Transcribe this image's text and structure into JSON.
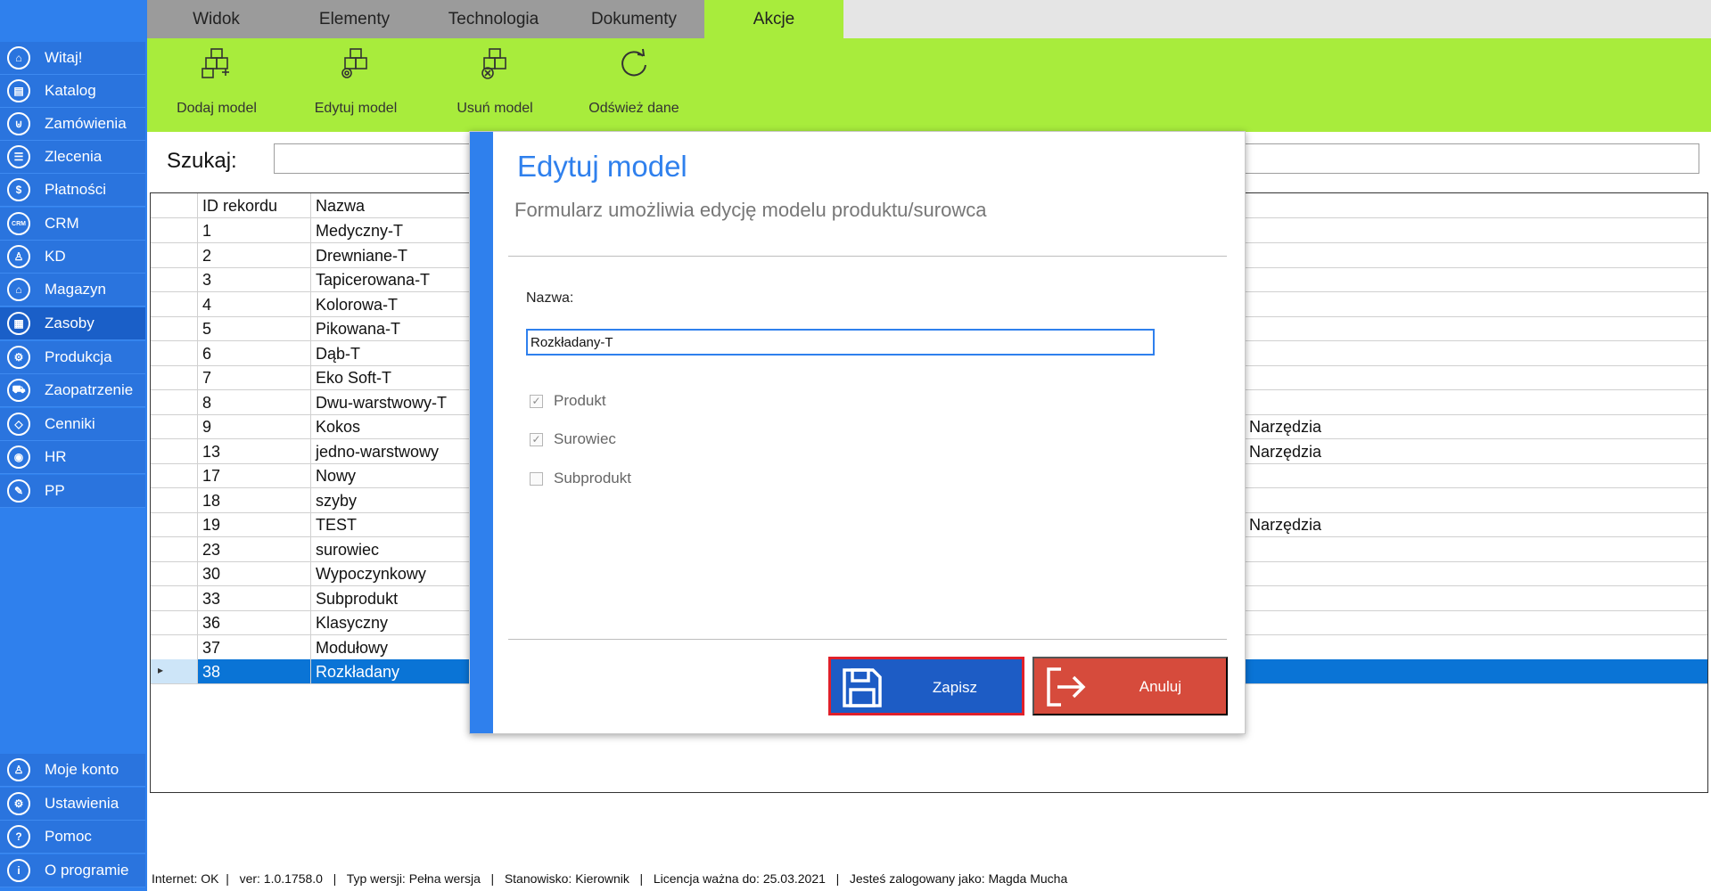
{
  "sidebar": {
    "items": [
      {
        "label": "Witaj!",
        "icon": "home-icon",
        "glyph": "⌂"
      },
      {
        "label": "Katalog",
        "icon": "book-icon",
        "glyph": "▤"
      },
      {
        "label": "Zamówienia",
        "icon": "cart-icon",
        "glyph": "⊍"
      },
      {
        "label": "Zlecenia",
        "icon": "list-icon",
        "glyph": "☰"
      },
      {
        "label": "Płatności",
        "icon": "dollar-icon",
        "glyph": "$"
      },
      {
        "label": "CRM",
        "icon": "crm-icon",
        "glyph": "CRM"
      },
      {
        "label": "KD",
        "icon": "person-icon",
        "glyph": "♙"
      },
      {
        "label": "Magazyn",
        "icon": "warehouse-icon",
        "glyph": "⌂"
      },
      {
        "label": "Zasoby",
        "icon": "resources-icon",
        "glyph": "▦"
      },
      {
        "label": "Produkcja",
        "icon": "production-icon",
        "glyph": "⚙"
      },
      {
        "label": "Zaopatrzenie",
        "icon": "truck-icon",
        "glyph": "⛟"
      },
      {
        "label": "Cenniki",
        "icon": "tag-icon",
        "glyph": "◇"
      },
      {
        "label": "HR",
        "icon": "hr-icon",
        "glyph": "◉"
      },
      {
        "label": "PP",
        "icon": "pp-icon",
        "glyph": "✎"
      }
    ],
    "bottom_items": [
      {
        "label": "Moje konto",
        "icon": "account-icon",
        "glyph": "♙"
      },
      {
        "label": "Ustawienia",
        "icon": "settings-icon",
        "glyph": "⚙"
      },
      {
        "label": "Pomoc",
        "icon": "help-icon",
        "glyph": "?"
      },
      {
        "label": "O programie",
        "icon": "info-icon",
        "glyph": "i"
      }
    ],
    "active": "Zasoby"
  },
  "tabs": [
    "Widok",
    "Elementy",
    "Technologia",
    "Dokumenty",
    "Akcje"
  ],
  "active_tab": "Akcje",
  "ribbon": {
    "buttons": [
      {
        "label": "Dodaj model",
        "icon": "add-model-icon"
      },
      {
        "label": "Edytuj model",
        "icon": "edit-model-icon"
      },
      {
        "label": "Usuń model",
        "icon": "delete-model-icon"
      },
      {
        "label": "Odśwież dane",
        "icon": "refresh-icon"
      }
    ]
  },
  "search": {
    "label": "Szukaj:",
    "value": ""
  },
  "grid": {
    "columns": [
      "ID rekordu",
      "Nazwa"
    ],
    "rows": [
      {
        "id": "1",
        "name": "Medyczny-T",
        "extra": ""
      },
      {
        "id": "2",
        "name": "Drewniane-T",
        "extra": ""
      },
      {
        "id": "3",
        "name": "Tapicerowana-T",
        "extra": ""
      },
      {
        "id": "4",
        "name": "Kolorowa-T",
        "extra": ""
      },
      {
        "id": "5",
        "name": "Pikowana-T",
        "extra": ""
      },
      {
        "id": "6",
        "name": "Dąb-T",
        "extra": ""
      },
      {
        "id": "7",
        "name": "Eko Soft-T",
        "extra": ""
      },
      {
        "id": "8",
        "name": "Dwu-warstwowy-T",
        "extra": ""
      },
      {
        "id": "9",
        "name": "Kokos",
        "extra": ", Narzędzia"
      },
      {
        "id": "13",
        "name": "jedno-warstwowy",
        "extra": ", Narzędzia"
      },
      {
        "id": "17",
        "name": "Nowy",
        "extra": ""
      },
      {
        "id": "18",
        "name": "szyby",
        "extra": ""
      },
      {
        "id": "19",
        "name": "TEST",
        "extra": ", Narzędzia"
      },
      {
        "id": "23",
        "name": "surowiec",
        "extra": ""
      },
      {
        "id": "30",
        "name": "Wypoczynkowy",
        "extra": ""
      },
      {
        "id": "33",
        "name": "Subprodukt",
        "extra": ""
      },
      {
        "id": "36",
        "name": "Klasyczny",
        "extra": ""
      },
      {
        "id": "37",
        "name": "Modułowy",
        "extra": ""
      },
      {
        "id": "38",
        "name": "Rozkładany",
        "extra": ""
      }
    ],
    "selected_id": "38"
  },
  "modal": {
    "title": "Edytuj model",
    "subtitle": "Formularz umożliwia edycję modelu produktu/surowca",
    "name_label": "Nazwa:",
    "name_value": "Rozkładany-T",
    "checkboxes": [
      {
        "label": "Produkt",
        "checked": true
      },
      {
        "label": "Surowiec",
        "checked": true
      },
      {
        "label": "Subprodukt",
        "checked": false
      }
    ],
    "save_label": "Zapisz",
    "cancel_label": "Anuluj"
  },
  "status": "Internet: OK  |   ver: 1.0.1758.0   |   Typ wersji: Pełna wersja   |   Stanowisko: Kierownik   |   Licencja ważna do: 25.03.2021   |   Jesteś zalogowany jako: Magda Mucha",
  "colors": {
    "accent": "#2f80ed",
    "ribbon": "#a8ec3c",
    "save": "#1d5cc5",
    "cancel": "#d64b3c",
    "selected_row": "#0a74d6"
  }
}
